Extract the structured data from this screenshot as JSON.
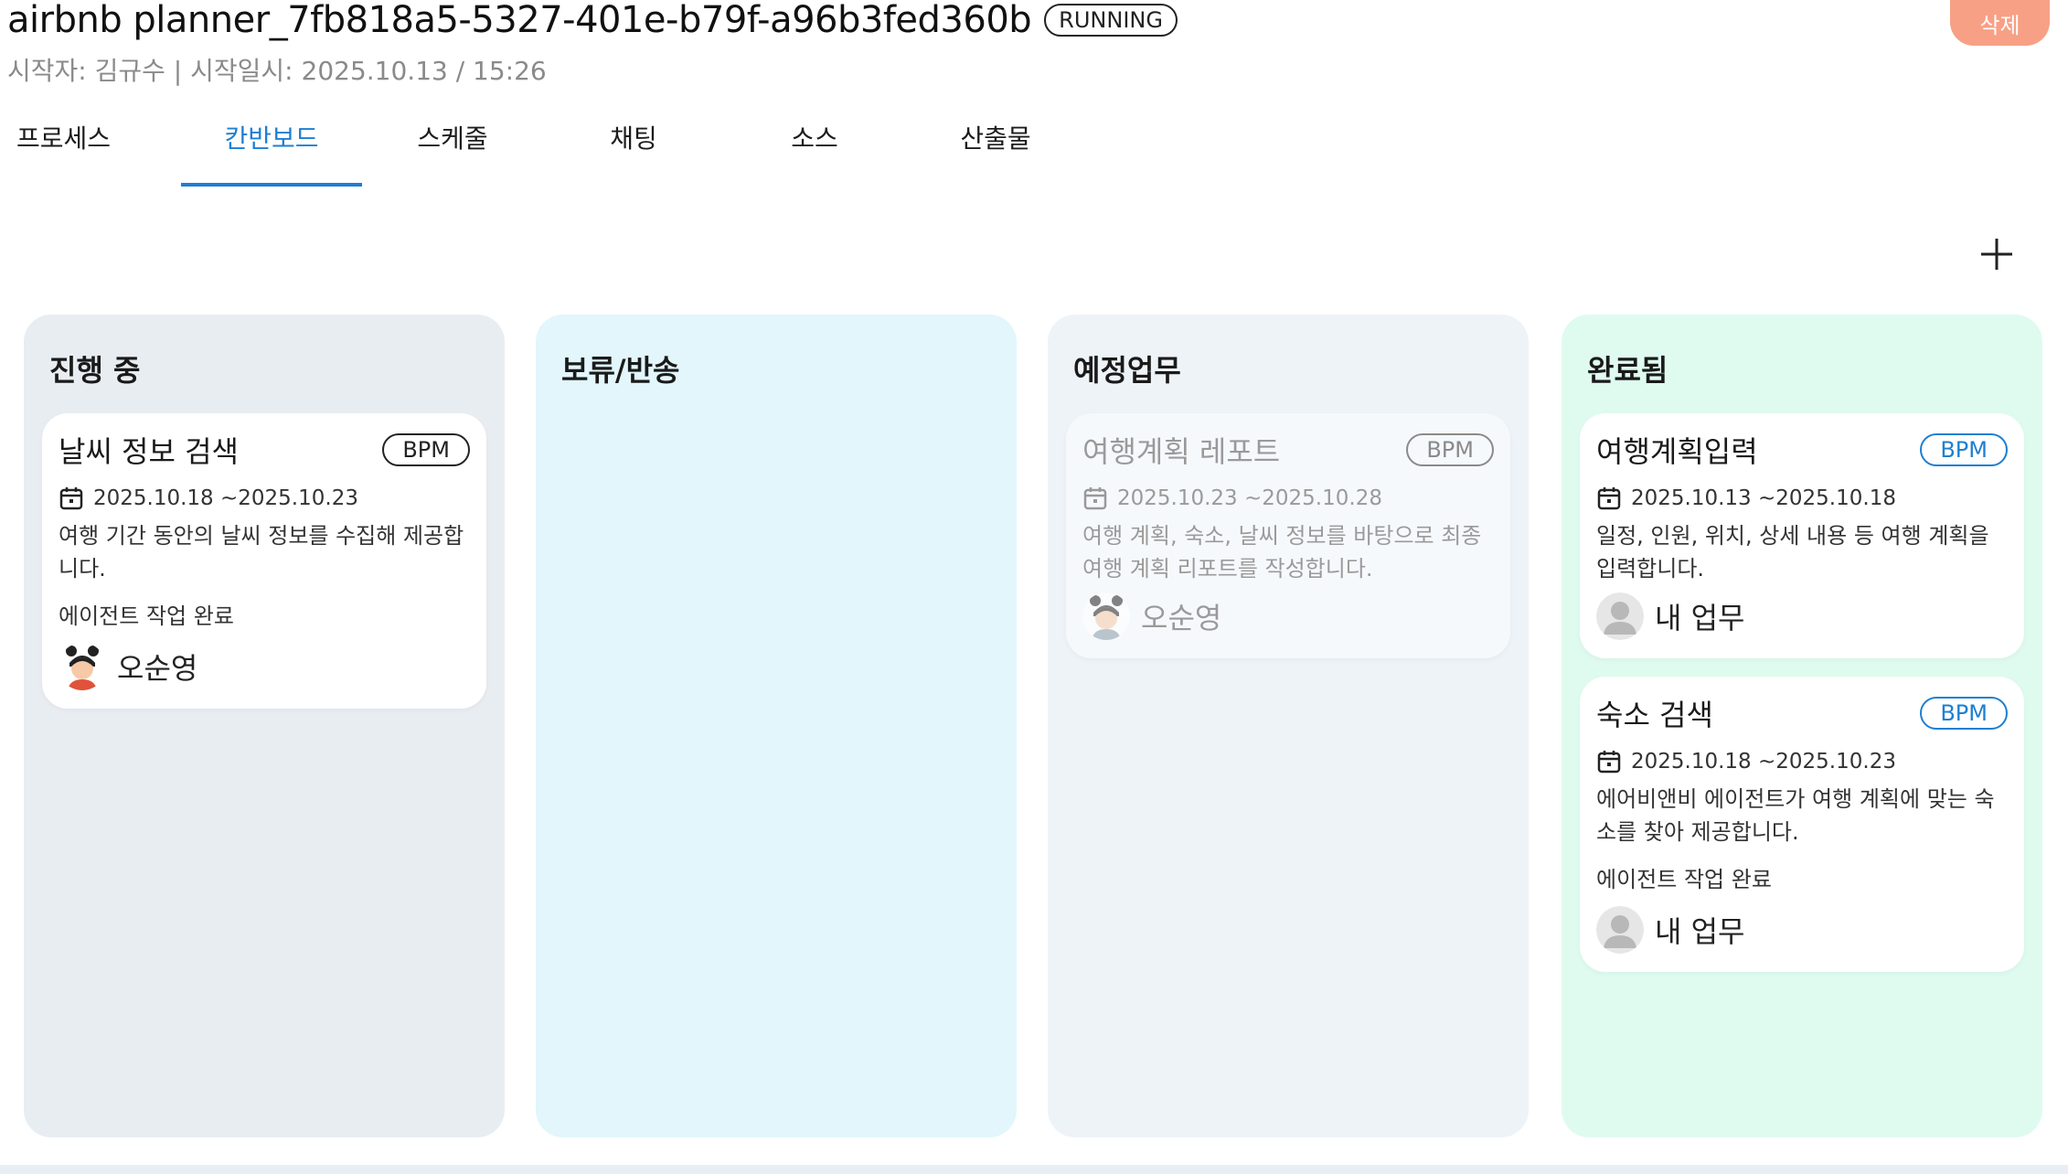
{
  "header": {
    "title": "airbnb planner_7fb818a5-5327-401e-b79f-a96b3fed360b",
    "status": "RUNNING",
    "delete_label": "삭제",
    "subtitle": "시작자: 김규수 | 시작일시: 2025.10.13 / 15:26"
  },
  "tabs": [
    {
      "label": "프로세스"
    },
    {
      "label": "칸반보드"
    },
    {
      "label": "스케줄"
    },
    {
      "label": "채팅"
    },
    {
      "label": "소스"
    },
    {
      "label": "산출물"
    }
  ],
  "active_tab": "칸반보드",
  "add_icon": "plus-icon",
  "columns": [
    {
      "title": "진행 중",
      "color": "#e8edf2",
      "cards": [
        {
          "title": "날씨 정보 검색",
          "badge": "BPM",
          "date": "2025.10.18 ~2025.10.23",
          "description": "여행 기간 동안의 날씨 정보를 수집해 제공합니다.",
          "status": "에이전트 작업 완료",
          "assignee": "오순영"
        }
      ]
    },
    {
      "title": "보류/반송",
      "color": "#e2f6fc",
      "cards": []
    },
    {
      "title": "예정업무",
      "color": "#eef3f8",
      "cards": [
        {
          "title": "여행계획 레포트",
          "badge": "BPM",
          "date": "2025.10.23 ~2025.10.28",
          "description": "여행 계획, 숙소, 날씨 정보를 바탕으로 최종 여행 계획 리포트를 작성합니다.",
          "assignee": "오순영"
        }
      ]
    },
    {
      "title": "완료됨",
      "color": "#dffbf0",
      "cards": [
        {
          "title": "여행계획입력",
          "badge": "BPM",
          "date": "2025.10.13 ~2025.10.18",
          "description": "일정, 인원, 위치, 상세 내용 등 여행 계획을 입력합니다.",
          "assignee": "내 업무"
        },
        {
          "title": "숙소 검색",
          "badge": "BPM",
          "date": "2025.10.18 ~2025.10.23",
          "description": "에어비앤비 에이전트가 여행 계획에 맞는 숙소를 찾아 제공합니다.",
          "status": "에이전트 작업 완료",
          "assignee": "내 업무"
        }
      ]
    }
  ],
  "colors": {
    "accent": "#1e7fd0",
    "delete": "#f8a085"
  }
}
